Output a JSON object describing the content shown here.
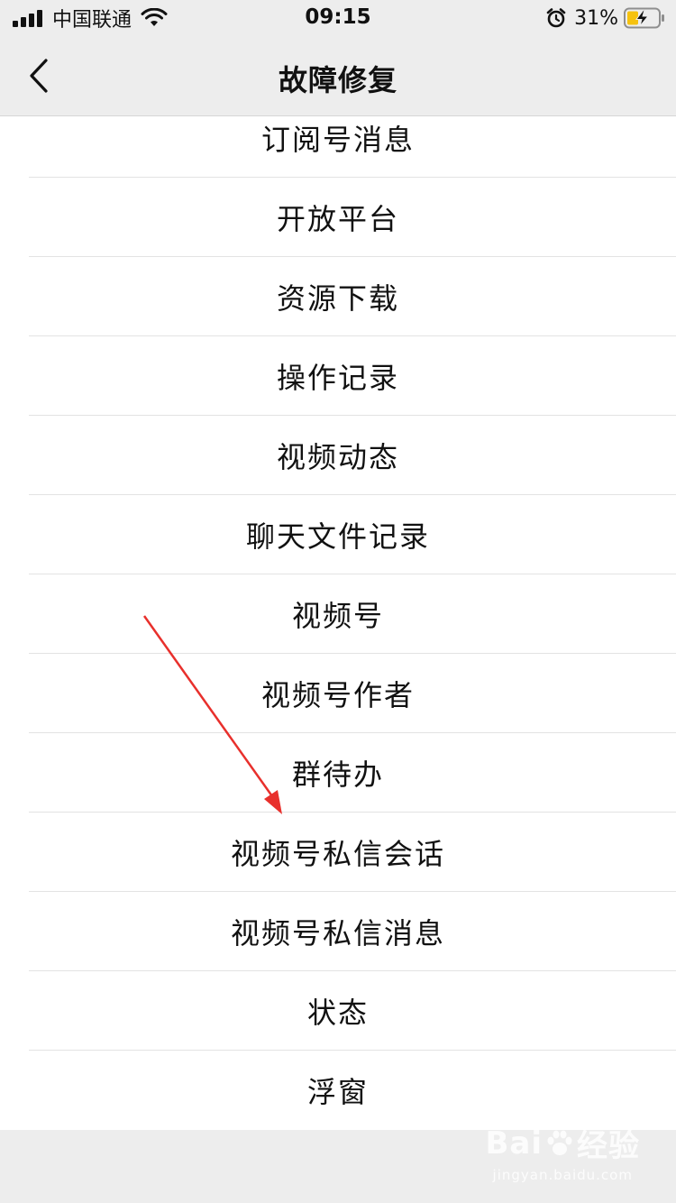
{
  "status_bar": {
    "carrier": "中国联通",
    "time": "09:15",
    "battery_percent": "31%",
    "icons": [
      "signal-icon",
      "wifi-icon",
      "alarm-icon",
      "battery-charging-icon"
    ]
  },
  "nav": {
    "title": "故障修复",
    "back_icon": "chevron-left-icon"
  },
  "list": {
    "items": [
      "订阅号消息",
      "开放平台",
      "资源下载",
      "操作记录",
      "视频动态",
      "聊天文件记录",
      "视频号",
      "视频号作者",
      "群待办",
      "视频号私信会话",
      "视频号私信消息",
      "状态",
      "浮窗"
    ]
  },
  "watermark": {
    "main_prefix": "Bai",
    "main_suffix": "经验",
    "sub": "jingyan.baidu.com"
  },
  "colors": {
    "background": "#ededed",
    "list_background": "#ffffff",
    "arrow": "#e8302c"
  }
}
